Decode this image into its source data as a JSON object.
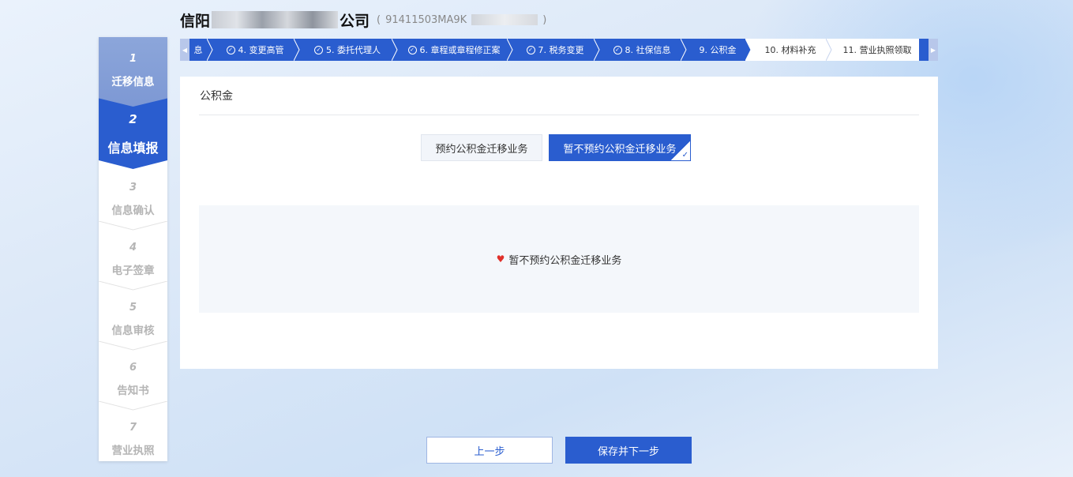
{
  "header": {
    "company_prefix": "信阳",
    "company_suffix": "公司",
    "credit_open": "(",
    "credit_code_visible": "91411503MA9K",
    "credit_close": ")"
  },
  "steps": [
    {
      "num": "1",
      "label": "迁移信息",
      "state": "done"
    },
    {
      "num": "2",
      "label": "信息填报",
      "state": "active"
    },
    {
      "num": "3",
      "label": "信息确认",
      "state": "todo"
    },
    {
      "num": "4",
      "label": "电子签章",
      "state": "todo"
    },
    {
      "num": "5",
      "label": "信息审核",
      "state": "todo"
    },
    {
      "num": "6",
      "label": "告知书",
      "state": "todo"
    },
    {
      "num": "7",
      "label": "营业执照",
      "state": "todo"
    }
  ],
  "crumbs": {
    "prev_arrow": "◀",
    "next_arrow": "▶",
    "items": [
      {
        "label": "息",
        "state": "done",
        "check": false
      },
      {
        "label": "4. 变更高管",
        "state": "done",
        "check": true
      },
      {
        "label": "5. 委托代理人",
        "state": "done",
        "check": true
      },
      {
        "label": "6. 章程或章程修正案",
        "state": "done",
        "check": true
      },
      {
        "label": "7. 税务变更",
        "state": "done",
        "check": true
      },
      {
        "label": "8. 社保信息",
        "state": "done",
        "check": true
      },
      {
        "label": "9. 公积金",
        "state": "current",
        "check": false
      },
      {
        "label": "10. 材料补充",
        "state": "todo",
        "check": false
      },
      {
        "label": "11. 营业执照领取",
        "state": "todo",
        "check": false
      }
    ]
  },
  "card": {
    "title": "公积金",
    "option_a": "预约公积金迁移业务",
    "option_b": "暂不预约公积金迁移业务",
    "selected": "option_b",
    "info_text": "暂不预约公积金迁移业务"
  },
  "buttons": {
    "prev": "上一步",
    "next": "保存并下一步"
  },
  "colors": {
    "primary": "#2a5dcf",
    "done_step": "#8ca6da",
    "heart": "#e0302a"
  }
}
